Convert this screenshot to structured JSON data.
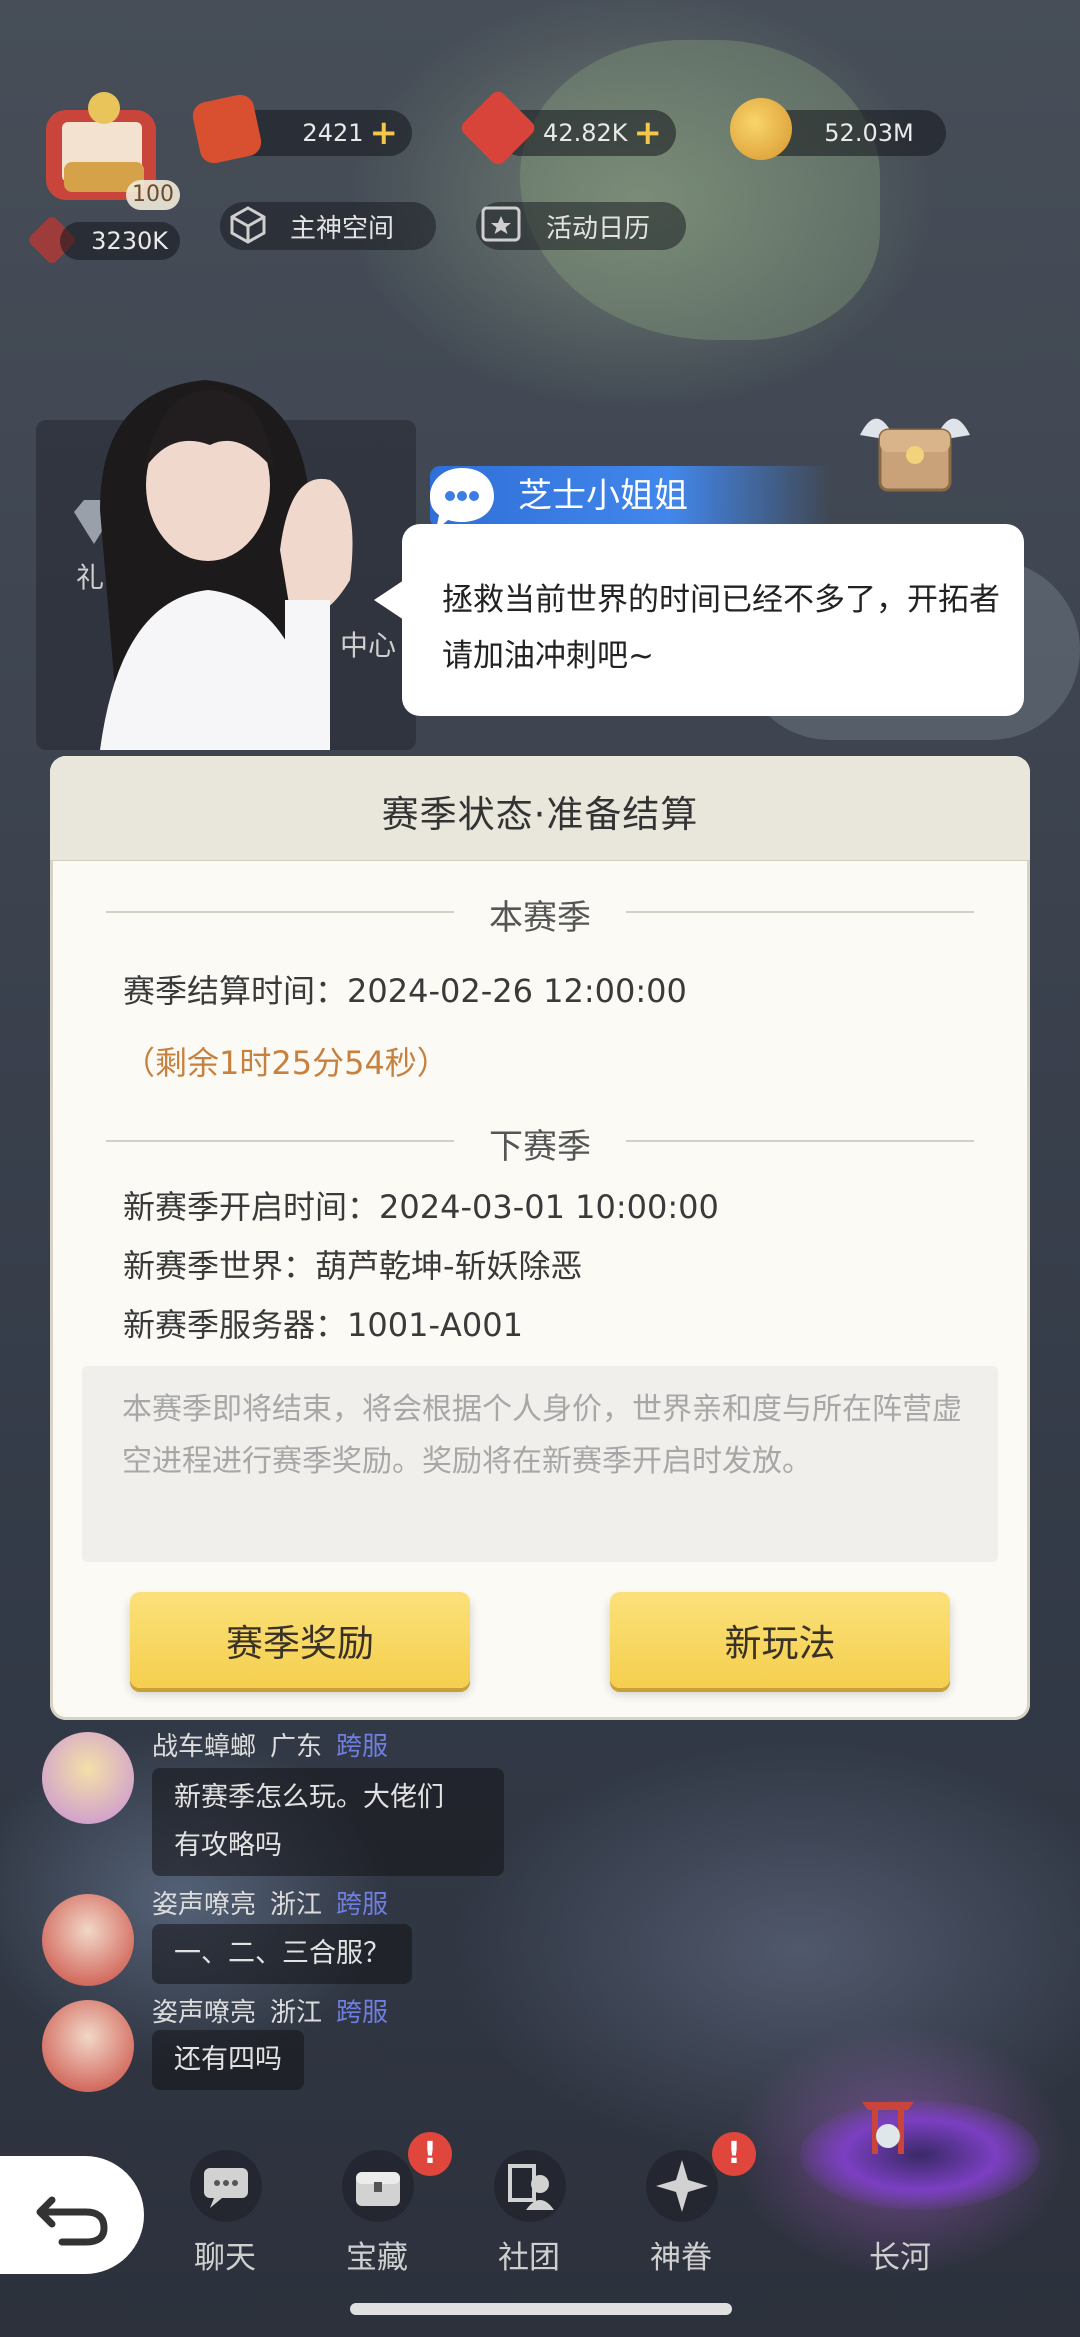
{
  "top_bar": {
    "avatar_level": "100",
    "power": "3230K",
    "tickets": "2421",
    "gems": "42.82K",
    "gold": "52.03M",
    "main_space_label": "主神空间",
    "calendar_label": "活动日历"
  },
  "side": {
    "gift_label": "礼包",
    "center_label": "中心"
  },
  "speaker": {
    "name": "芝士小姐姐",
    "message": "拯救当前世界的时间已经不多了，开拓者请加油冲刺吧~"
  },
  "dialog": {
    "title": "赛季状态·准备结算",
    "current_season": {
      "header": "本赛季",
      "settle_time": "赛季结算时间：2024-02-26 12:00:00",
      "remaining": "（剩余1时25分54秒）"
    },
    "next_season": {
      "header": "下赛季",
      "open_time": "新赛季开启时间：2024-03-01 10:00:00",
      "world": "新赛季世界：葫芦乾坤-斩妖除恶",
      "server": "新赛季服务器：1001-A001"
    },
    "note": "本赛季即将结束，将会根据个人身价，世界亲和度与所在阵营虚空进程进行赛季奖励。奖励将在新赛季开启时发放。",
    "rewards_button": "赛季奖励",
    "new_gameplay_button": "新玩法"
  },
  "chat": [
    {
      "name": "战车蟑螂",
      "location": "广东",
      "tag": "跨服",
      "message_lines": [
        "新赛季怎么玩。大佬们",
        "有攻略吗"
      ]
    },
    {
      "name": "姿声嘹亮",
      "location": "浙江",
      "tag": "跨服",
      "message_lines": [
        "一、二、三合服？"
      ]
    },
    {
      "name": "姿声嘹亮",
      "location": "浙江",
      "tag": "跨服",
      "message_lines": [
        "还有四吗"
      ]
    }
  ],
  "bottom_nav": [
    {
      "label": "聊天",
      "icon": "chat-icon",
      "badge": ""
    },
    {
      "label": "宝藏",
      "icon": "treasure-chest-icon",
      "badge": "!"
    },
    {
      "label": "社团",
      "icon": "guild-icon",
      "badge": ""
    },
    {
      "label": "神眷",
      "icon": "star-icon",
      "badge": "!"
    },
    {
      "label": "长河",
      "icon": "portal-icon",
      "badge": ""
    }
  ],
  "colors": {
    "dialog_bg": "#fbfaf5",
    "button_yellow": "#f5cf4e",
    "remaining_orange": "#c7813e",
    "speaker_blue": "#3a7de4",
    "cross_server_tag": "#6f7fe0",
    "badge_red": "#e0463c"
  }
}
